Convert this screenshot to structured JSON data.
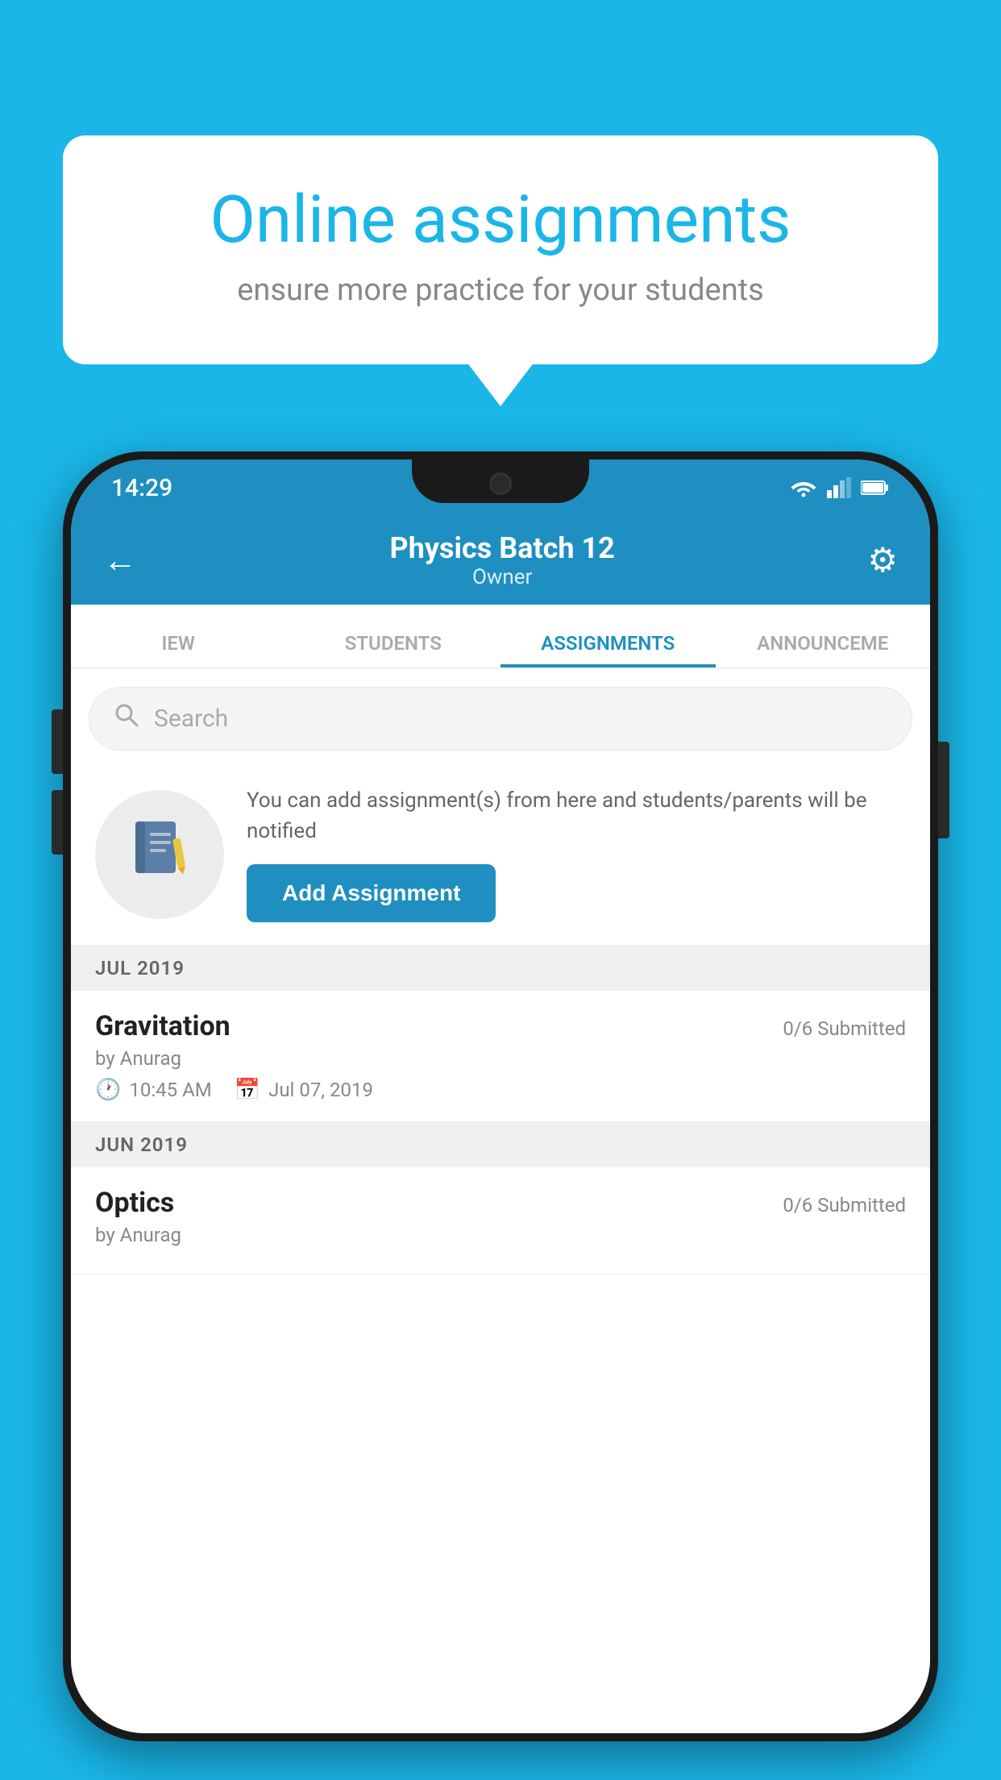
{
  "background_color": "#1ab6e8",
  "speech_bubble": {
    "title": "Online assignments",
    "subtitle": "ensure more practice for your students"
  },
  "status_bar": {
    "time": "14:29",
    "wifi": "▼",
    "signal": "▲",
    "battery": "▮"
  },
  "header": {
    "back_label": "←",
    "title": "Physics Batch 12",
    "subtitle": "Owner",
    "settings_label": "⚙"
  },
  "tabs": [
    {
      "label": "IEW",
      "active": false
    },
    {
      "label": "STUDENTS",
      "active": false
    },
    {
      "label": "ASSIGNMENTS",
      "active": true
    },
    {
      "label": "ANNOUNCE…",
      "active": false
    }
  ],
  "search": {
    "placeholder": "Search"
  },
  "promo": {
    "description": "You can add assignment(s) from here and students/parents will be notified",
    "button_label": "Add Assignment"
  },
  "sections": [
    {
      "label": "JUL 2019",
      "assignments": [
        {
          "title": "Gravitation",
          "submitted": "0/6 Submitted",
          "author": "by Anurag",
          "time": "10:45 AM",
          "date": "Jul 07, 2019"
        }
      ]
    },
    {
      "label": "JUN 2019",
      "assignments": [
        {
          "title": "Optics",
          "submitted": "0/6 Submitted",
          "author": "by Anurag",
          "time": "",
          "date": ""
        }
      ]
    }
  ]
}
